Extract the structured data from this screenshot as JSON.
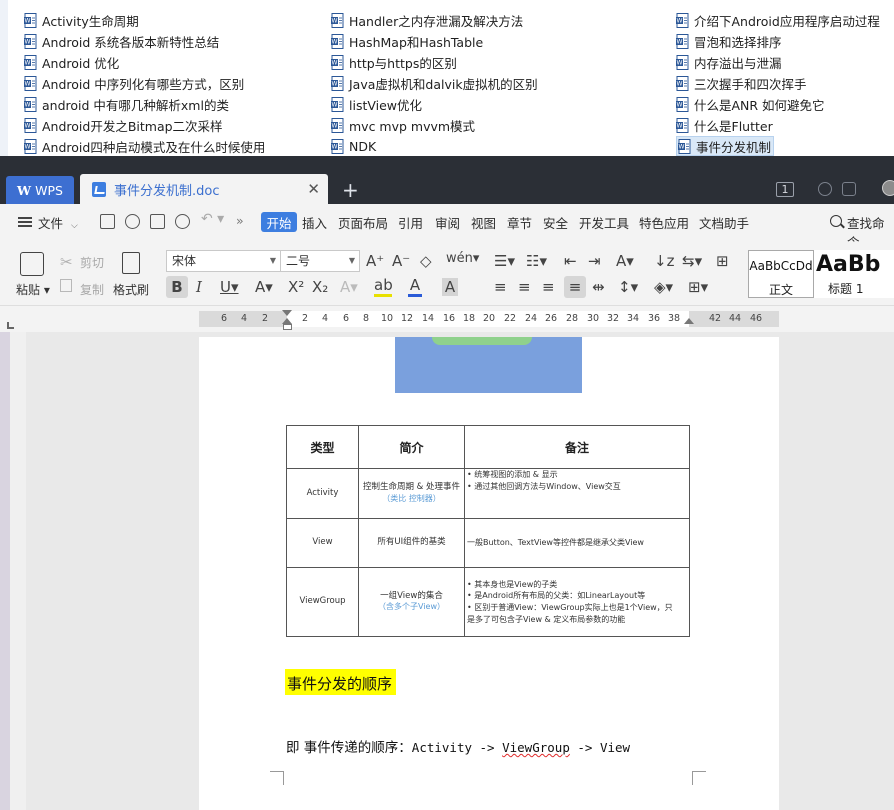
{
  "file_list": {
    "columns": [
      [
        "Activity生命周期",
        "Android 系统各版本新特性总结",
        "Android 优化",
        "Android 中序列化有哪些方式，区别",
        "android 中有哪几种解析xml的类",
        "Android开发之Bitmap二次采样",
        "Android四种启动模式及在什么时候使用"
      ],
      [
        "Handler之内存泄漏及解决方法",
        "HashMap和HashTable",
        "http与https的区别",
        "Java虚拟机和dalvik虚拟机的区别",
        "listView优化",
        "mvc  mvp  mvvm模式",
        "NDK"
      ],
      [
        "介绍下Android应用程序启动过程",
        "冒泡和选择排序",
        "内存溢出与泄漏",
        "三次握手和四次挥手",
        "什么是ANR 如何避免它",
        "什么是Flutter",
        "事件分发机制"
      ]
    ],
    "selected": "事件分发机制",
    "icon": "word-doc-icon"
  },
  "titlebar": {
    "app_tab": "WPS",
    "doc_tab": "事件分发机制.doc",
    "close_glyph": "✕",
    "new_tab_glyph": "+",
    "badge": "1"
  },
  "menubar": {
    "file_menu": "文件",
    "items": [
      "开始",
      "插入",
      "页面布局",
      "引用",
      "审阅",
      "视图",
      "章节",
      "安全",
      "开发工具",
      "特色应用",
      "文档助手"
    ],
    "active": "开始",
    "search": "查找命令"
  },
  "ribbon": {
    "paste": "粘贴",
    "cut": "剪切",
    "copy": "复制",
    "format_painter": "格式刷",
    "font_name": "宋体",
    "font_size": "二号",
    "styles": [
      {
        "sample": "AaBbCcDd",
        "name": "正文"
      },
      {
        "sample": "AaBb",
        "name": "标题 1"
      }
    ]
  },
  "ruler": {
    "ticks": [
      "6",
      "4",
      "2",
      "2",
      "4",
      "6",
      "8",
      "10",
      "12",
      "14",
      "16",
      "18",
      "20",
      "22",
      "24",
      "26",
      "28",
      "30",
      "32",
      "34",
      "36",
      "38",
      "42",
      "44",
      "46"
    ]
  },
  "document": {
    "table": {
      "headers": [
        "类型",
        "简介",
        "备注"
      ],
      "rows": [
        {
          "type": "Activity",
          "intro": "控制生命周期 & 处理事件",
          "intro_note": "（类比 控制器）",
          "remarks": [
            "• 统筹视图的添加 & 显示",
            "• 通过其他回调方法与Window、View交互"
          ]
        },
        {
          "type": "View",
          "intro": "所有UI组件的基类",
          "intro_note": "",
          "remarks": [
            "一般Button、TextView等控件都是继承父类View"
          ]
        },
        {
          "type": "ViewGroup",
          "intro": "一组View的集合",
          "intro_note": "（含多个子View）",
          "remarks": [
            "• 其本身也是View的子类",
            "• 是Android所有布局的父类：如LinearLayout等",
            "• 区别于普通View：ViewGroup实际上也是1个View，只",
            "是多了可包含子View & 定义布局参数的功能"
          ]
        }
      ]
    },
    "heading": "事件分发的顺序",
    "sentence_prefix": "即 事件传递的顺序：",
    "sentence_code_a": "Activity -> ",
    "sentence_code_b": "ViewGroup",
    "sentence_code_c": " -> View"
  },
  "colors": {
    "accent": "#3d7ee0",
    "titlebar": "#2b2f36",
    "highlight": "#ffff00",
    "selected_row": "#d9e8f7"
  }
}
